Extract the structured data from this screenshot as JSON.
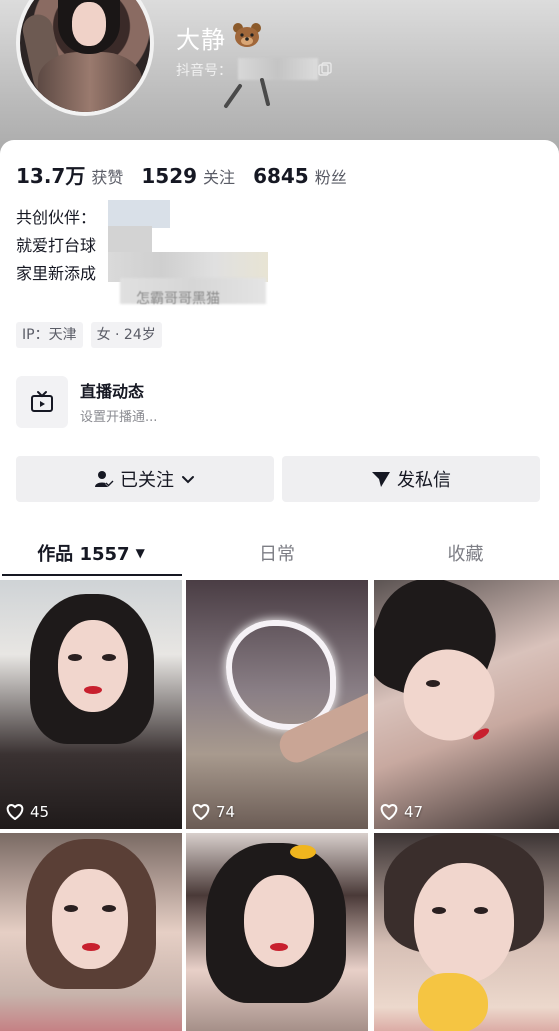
{
  "profile": {
    "nickname": "大静",
    "nickname_emoji": "bear-face-emoji",
    "account_id_label": "抖音号：",
    "stats": [
      {
        "value": "13.7万",
        "label": "获赞"
      },
      {
        "value": "1529",
        "label": "关注"
      },
      {
        "value": "6845",
        "label": "粉丝"
      }
    ],
    "bio_lines": [
      "共创伙伴：",
      "就爱打台球",
      "家里新添成"
    ],
    "bio_tail": "怎霸哥哥黑猫",
    "tags": [
      "IP：天津",
      "女 · 24岁"
    ]
  },
  "live": {
    "title": "直播动态",
    "subtitle": "设置开播通..."
  },
  "actions": {
    "follow_label": "已关注",
    "message_label": "发私信"
  },
  "tabs": [
    {
      "label": "作品 1557"
    },
    {
      "label": "日常"
    },
    {
      "label": "收藏"
    }
  ],
  "videos": [
    {
      "likes": "45"
    },
    {
      "likes": "74"
    },
    {
      "likes": "47"
    },
    {
      "likes": ""
    },
    {
      "likes": ""
    },
    {
      "likes": ""
    }
  ],
  "colors": {
    "text_primary": "#161823",
    "text_secondary": "#5a5c66",
    "button_bg": "#efeff1",
    "tag_bg": "#f2f2f4"
  }
}
